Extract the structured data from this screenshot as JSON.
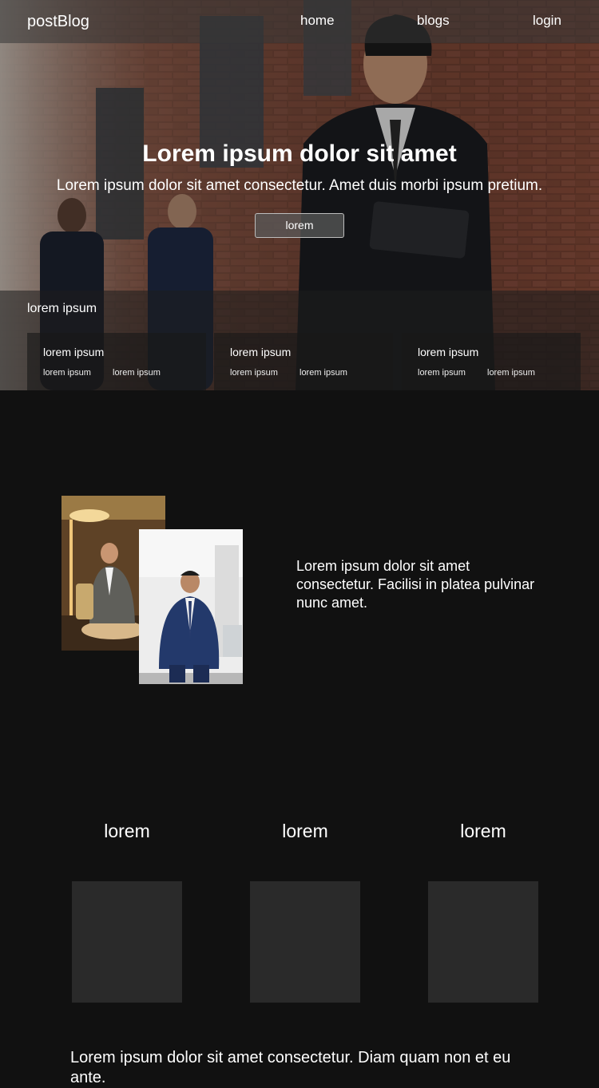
{
  "navbar": {
    "brand": "postBlog",
    "links": [
      "home",
      "blogs",
      "login"
    ]
  },
  "hero": {
    "title": "Lorem ipsum dolor sit amet",
    "subtitle": "Lorem ipsum dolor sit amet consectetur. Amet duis morbi ipsum pretium.",
    "button_label": "lorem"
  },
  "hero_panel": {
    "title": "lorem ipsum",
    "cards": [
      {
        "title": "lorem ipsum",
        "links": [
          "lorem ipsum",
          "lorem ipsum"
        ]
      },
      {
        "title": "lorem ipsum",
        "links": [
          "lorem ipsum",
          "lorem ipsum"
        ]
      },
      {
        "title": "lorem ipsum",
        "links": [
          "lorem ipsum",
          "lorem ipsum"
        ]
      }
    ]
  },
  "about": {
    "text": "Lorem ipsum dolor sit amet consectetur. Facilisi in platea pulvinar nunc amet."
  },
  "columns": [
    {
      "heading": "lorem"
    },
    {
      "heading": "lorem"
    },
    {
      "heading": "lorem"
    }
  ],
  "footer": {
    "text": "Lorem ipsum dolor sit amet consectetur. Diam quam non et eu ante."
  },
  "colors": {
    "page_background": "#111111",
    "column_box": "#2a2a2a",
    "text": "#ffffff"
  }
}
